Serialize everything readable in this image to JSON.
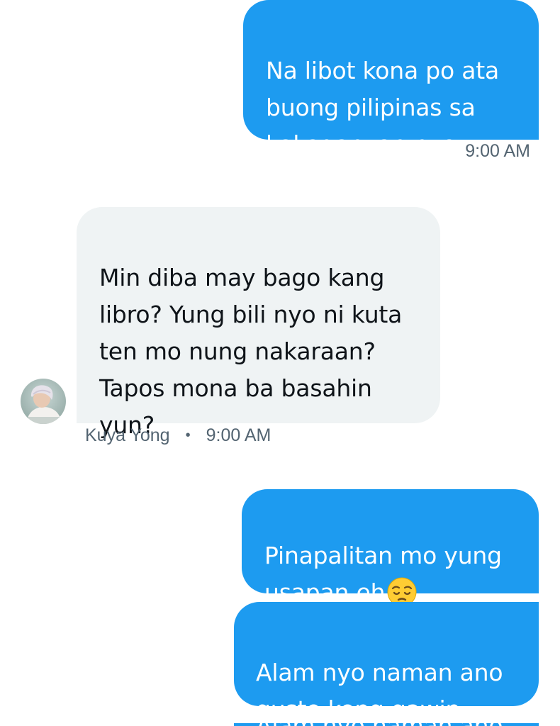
{
  "conversation": {
    "messages": [
      {
        "direction": "outgoing",
        "text": "Na libot kona po ata\nbuong pilipinas sa\nkakaganyan nyo",
        "timestamp": "9:00 AM"
      },
      {
        "direction": "incoming",
        "sender": "Kuya Yong",
        "text": "Min diba may bago kang\nlibro? Yung bili nyo ni kuta\nten mo nung nakaraan?\nTapos mona ba basahin\nyun?",
        "timestamp": "9:00 AM"
      },
      {
        "direction": "outgoing",
        "text": "Pinapalitan mo yung\nusapan eh",
        "emoji": "pensive-face"
      },
      {
        "direction": "outgoing",
        "text": "Alam nyo naman ano\ngusto kong gawin"
      },
      {
        "direction": "outgoing",
        "text": "Alam nyo naman ano",
        "partially_visible": true
      }
    ]
  },
  "meta_separator": "•",
  "colors": {
    "outgoing_bubble": "#1d9bf0",
    "incoming_bubble": "#eff3f4",
    "outgoing_text": "#ffffff",
    "incoming_text": "#0f1419",
    "meta_text": "#536471",
    "emoji": "#ffcc33"
  },
  "icons": {
    "avatar": "user-avatar",
    "emoji": "pensive-face-emoji"
  }
}
